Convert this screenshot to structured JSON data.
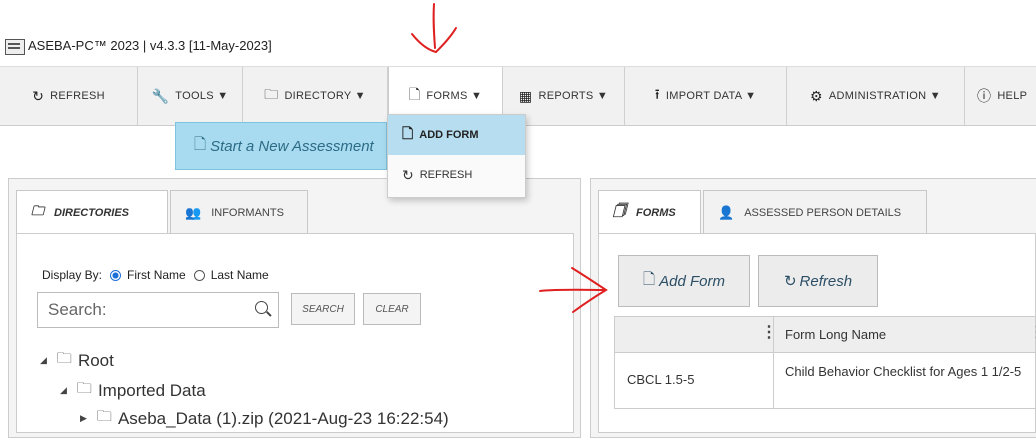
{
  "app": {
    "title": "ASEBA-PC™ 2023 | v4.3.3  [11-May-2023]"
  },
  "toolbar": {
    "refresh": "REFRESH",
    "tools": "TOOLS ▼",
    "directory": "DIRECTORY ▼",
    "forms": "FORMS ▼",
    "reports": "REPORTS ▼",
    "import_data": "IMPORT DATA ▼",
    "administration": "ADMINISTRATION ▼",
    "help": "HELP"
  },
  "start_assessment": "Start a New Assessment",
  "forms_menu": {
    "add_form": "ADD FORM",
    "refresh": "REFRESH"
  },
  "left": {
    "tabs": [
      "DIRECTORIES",
      "INFORMANTS"
    ],
    "display_by_label": "Display By:",
    "first_name": "First Name",
    "last_name": "Last Name",
    "search_placeholder": "Search:",
    "search_button": "SEARCH",
    "clear_button": "CLEAR",
    "tree": [
      "Root",
      "Imported Data",
      "Aseba_Data (1).zip (2021-Aug-23 16:22:54)"
    ]
  },
  "right": {
    "tabs": [
      "FORMS",
      "ASSESSED PERSON DETAILS"
    ],
    "add_form": "Add Form",
    "refresh": "Refresh",
    "columns": [
      "",
      "Form Long Name"
    ],
    "rows": [
      {
        "code": "CBCL 1.5-5",
        "long_name": "Child Behavior Checklist for Ages 1 1/2-5"
      }
    ]
  },
  "colors": {
    "accent": "#a8dbef",
    "highlight": "#b6def0",
    "annotation": "#e02020"
  }
}
